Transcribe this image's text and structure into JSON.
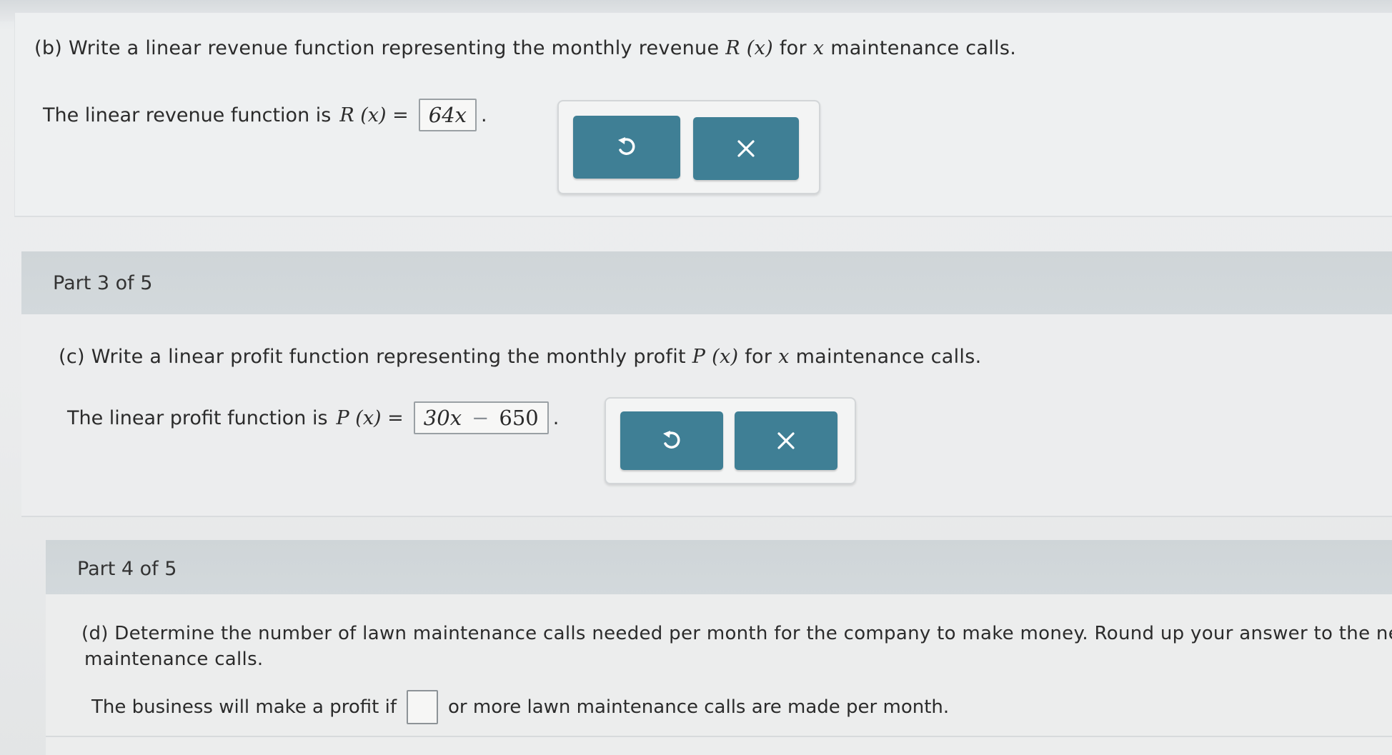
{
  "part_b": {
    "question_prefix": "(b) Write a linear revenue function representing the monthly revenue",
    "question_func": "R (x)",
    "question_mid": "for",
    "question_var": "x",
    "question_suffix": "maintenance calls.",
    "answer_prefix": "The linear revenue function is",
    "answer_func": "R (x) =",
    "answer_value": "64x",
    "answer_period": ".",
    "undo_icon": "undo-icon",
    "clear_icon": "close-icon"
  },
  "part_3_header": "Part 3 of 5",
  "part_c": {
    "question_prefix": "(c) Write a linear profit function representing the monthly profit",
    "question_func": "P (x)",
    "question_mid": "for",
    "question_var": "x",
    "question_suffix": "maintenance calls.",
    "answer_prefix": "The linear profit function is",
    "answer_func": "P (x) =",
    "answer_value_term": "30x",
    "answer_value_op": "−",
    "answer_value_const": "650",
    "answer_period": ".",
    "undo_icon": "undo-icon",
    "clear_icon": "close-icon"
  },
  "part_4_header": "Part 4 of 5",
  "part_d": {
    "question_line1": "(d) Determine the number of lawn maintenance calls needed per month for the company to make money. Round up your answer to the neare",
    "question_line2": "maintenance calls.",
    "answer_prefix": "The business will make a profit if",
    "answer_value": "",
    "answer_suffix": "or more lawn maintenance calls are made per month."
  },
  "colors": {
    "button": "#3f7f95",
    "header": "#d1d7da",
    "panel": "#eceded"
  }
}
